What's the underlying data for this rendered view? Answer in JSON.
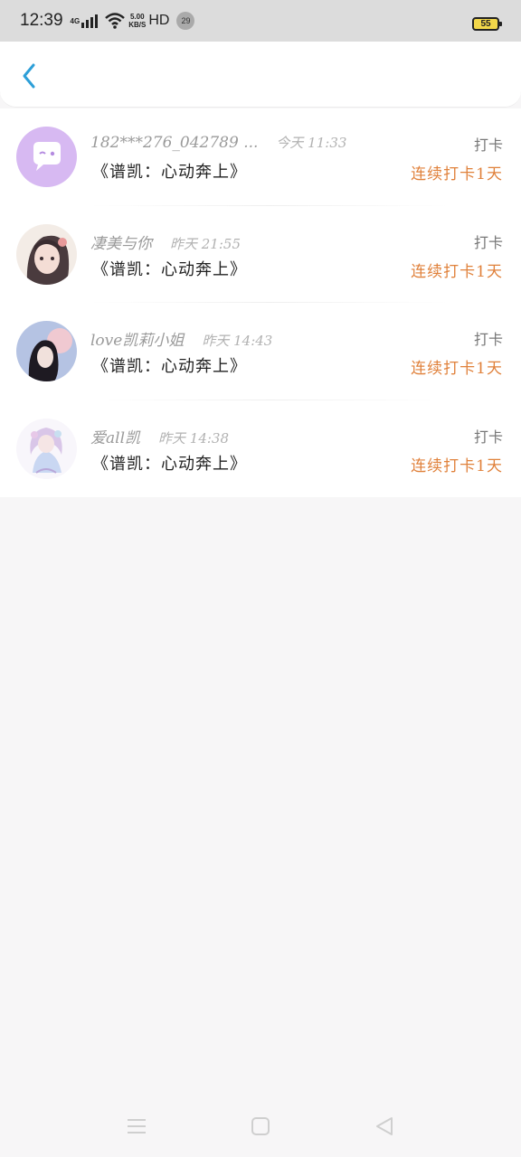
{
  "status_bar": {
    "time": "12:39",
    "network": "4G",
    "speed_top": "5.00",
    "speed_bottom": "KB/S",
    "hd": "HD",
    "notification_count": "29",
    "battery": "55"
  },
  "header": {
    "back_icon": "chevron-left-icon",
    "accent_color": "#2d9fd8"
  },
  "records": [
    {
      "name": "182***276_042789 ...",
      "time": "今天 11:33",
      "song": "《谱凯：心动奔上》",
      "check_label": "打卡",
      "streak": "连续打卡1天",
      "avatar": "chat-bubble-avatar"
    },
    {
      "name": "凄美与你",
      "time": "昨天 21:55",
      "song": "《谱凯：心动奔上》",
      "check_label": "打卡",
      "streak": "连续打卡1天",
      "avatar": "anime-girl-avatar"
    },
    {
      "name": "love凯莉小姐",
      "time": "昨天 14:43",
      "song": "《谱凯：心动奔上》",
      "check_label": "打卡",
      "streak": "连续打卡1天",
      "avatar": "anime-girl-dark-hair-avatar"
    },
    {
      "name": "爱all凯",
      "time": "昨天 14:38",
      "song": "《谱凯：心动奔上》",
      "check_label": "打卡",
      "streak": "连续打卡1天",
      "avatar": "anime-girl-pastel-avatar"
    }
  ],
  "colors": {
    "streak": "#e0813b",
    "background": "#f7f6f7"
  },
  "nav_bar": {
    "menu_icon": "menu-icon",
    "home_icon": "home-square-icon",
    "back_icon": "back-triangle-icon"
  }
}
